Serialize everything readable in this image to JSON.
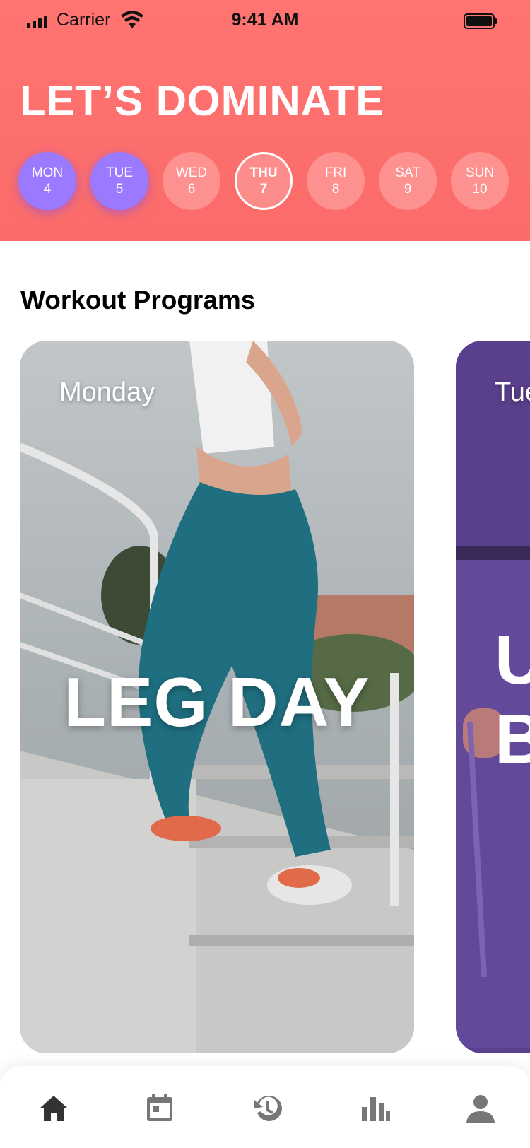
{
  "status_bar": {
    "carrier": "Carrier",
    "time": "9:41 AM"
  },
  "header": {
    "title": "LET’S DOMINATE"
  },
  "days": [
    {
      "name": "MON",
      "date": "4",
      "state": "done"
    },
    {
      "name": "TUE",
      "date": "5",
      "state": "done"
    },
    {
      "name": "WED",
      "date": "6",
      "state": "upcoming"
    },
    {
      "name": "THU",
      "date": "7",
      "state": "today"
    },
    {
      "name": "FRI",
      "date": "8",
      "state": "upcoming"
    },
    {
      "name": "SAT",
      "date": "9",
      "state": "upcoming"
    },
    {
      "name": "SUN",
      "date": "10",
      "state": "upcoming"
    }
  ],
  "section": {
    "title": "Workout Programs"
  },
  "programs": [
    {
      "day": "Monday",
      "workout": "LEG DAY"
    },
    {
      "day": "Tue",
      "workout": "U\nB"
    }
  ],
  "tabs": [
    {
      "icon": "home-icon",
      "active": true
    },
    {
      "icon": "calendar-icon",
      "active": false
    },
    {
      "icon": "history-icon",
      "active": false
    },
    {
      "icon": "stats-icon",
      "active": false
    },
    {
      "icon": "profile-icon",
      "active": false
    }
  ],
  "colors": {
    "header": "#ff7471",
    "done_day": "#9b7aff",
    "tab_active": "#333333",
    "tab_inactive": "#777777"
  }
}
